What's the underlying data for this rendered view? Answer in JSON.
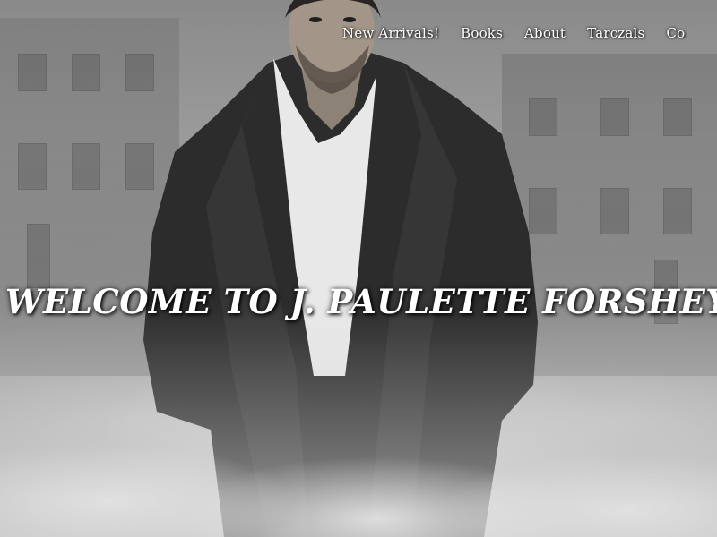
{
  "nav": {
    "items": [
      {
        "label": "New Arrivals!"
      },
      {
        "label": "Books"
      },
      {
        "label": "About"
      },
      {
        "label": "Tarczals"
      },
      {
        "label": "Co"
      }
    ]
  },
  "hero": {
    "title": "Welcome to J. Paulette Forshey.com"
  }
}
